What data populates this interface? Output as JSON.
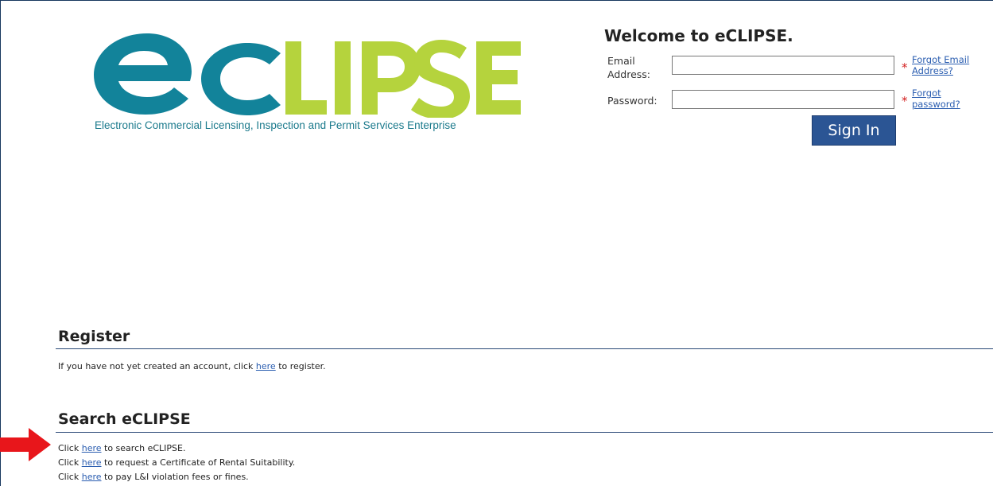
{
  "logo": {
    "wordmark": "eCLIPSE",
    "tagline": "Electronic Commercial Licensing, Inspection and Permit Services Enterprise",
    "colors": {
      "teal": "#12839a",
      "green": "#b5d33d"
    }
  },
  "login": {
    "welcome": "Welcome to eCLIPSE.",
    "email_label_line1": "Email",
    "email_label_line2": "Address:",
    "email_value": "",
    "password_label": "Password:",
    "password_value": "",
    "required_mark": "*",
    "forgot_email_line1": "Forgot Email",
    "forgot_email_line2": "Address?",
    "forgot_password_line1": "Forgot",
    "forgot_password_line2": "password?",
    "sign_in": "Sign In"
  },
  "register": {
    "title": "Register",
    "pre": "If you have not yet created an account, click ",
    "link": "here",
    "post": " to register."
  },
  "search": {
    "title": "Search eCLIPSE",
    "lines": [
      {
        "pre": "Click ",
        "link": "here",
        "post": " to search eCLIPSE."
      },
      {
        "pre": "Click ",
        "link": "here",
        "post": " to request a Certificate of Rental Suitability."
      },
      {
        "pre": "Click ",
        "link": "here",
        "post": " to pay L&I violation fees or fines."
      }
    ]
  },
  "annotation": {
    "arrow_icon": "red-arrow-icon",
    "arrow_color": "#e8161b"
  }
}
